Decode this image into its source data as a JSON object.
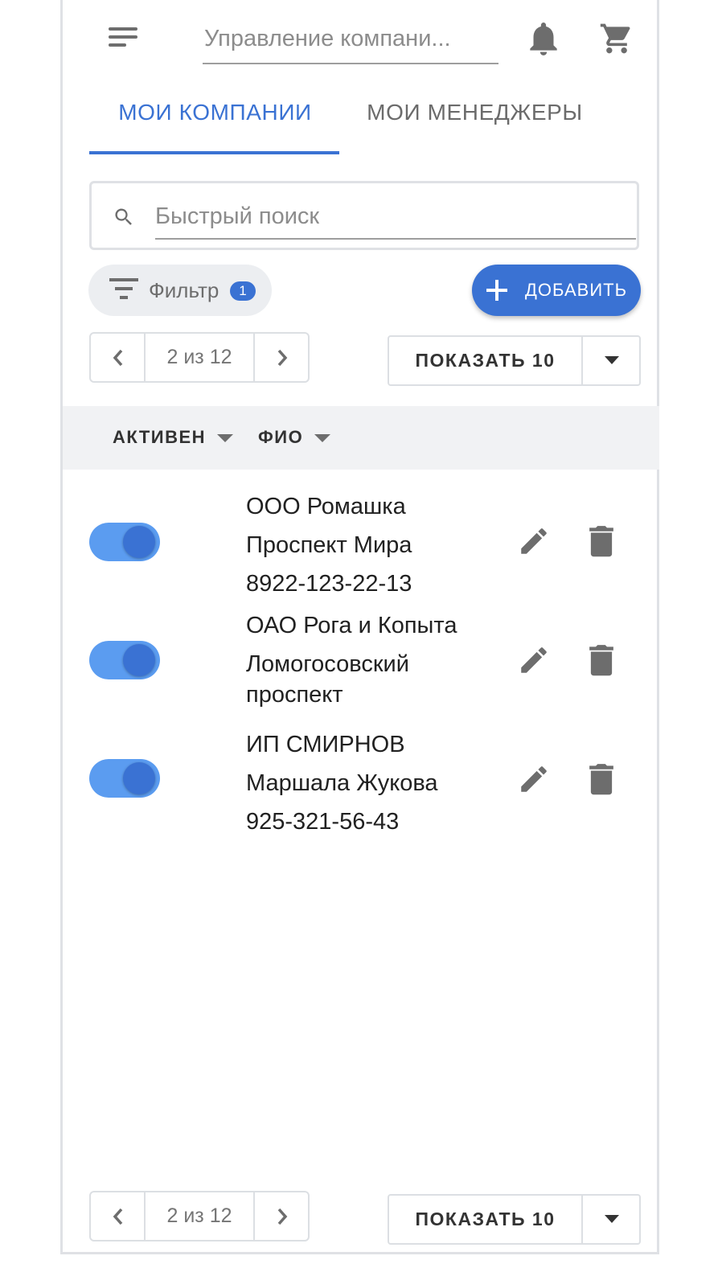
{
  "header": {
    "title": "Управление компани...",
    "icons": [
      "menu-icon",
      "bell-icon",
      "cart-icon"
    ]
  },
  "tabs": [
    {
      "label": "МОИ КОМПАНИИ",
      "active": true
    },
    {
      "label": "МОИ МЕНЕДЖЕРЫ",
      "active": false
    }
  ],
  "search": {
    "placeholder": "Быстрый поиск",
    "value": ""
  },
  "filter": {
    "label": "Фильтр",
    "count": "1"
  },
  "add_button": {
    "label": "ДОБАВИТЬ"
  },
  "pager_top": {
    "info": "2 из 12"
  },
  "page_size_top": {
    "label": "ПОКАЗАТЬ 10"
  },
  "columns": [
    {
      "label": "АКТИВЕН"
    },
    {
      "label": "ФИО"
    }
  ],
  "rows": [
    {
      "active": true,
      "name": "ООО Ромашка",
      "address": "Проспект Мира",
      "phone": "8922-123-22-13"
    },
    {
      "active": true,
      "name": "ОАО Рога и Копыта",
      "address": "Ломогосовский проспект",
      "phone": ""
    },
    {
      "active": true,
      "name": "ИП СМИРНОВ",
      "address": "Маршала Жукова",
      "phone": "925-321-56-43"
    }
  ],
  "pager_bottom": {
    "info": "2 из 12"
  },
  "page_size_bottom": {
    "label": "ПОКАЗАТЬ 10"
  },
  "colors": {
    "accent": "#3a72d3",
    "toggle_track": "#5b9cf0",
    "header_bg": "#f1f2f4",
    "icon": "#6d6d6d"
  }
}
